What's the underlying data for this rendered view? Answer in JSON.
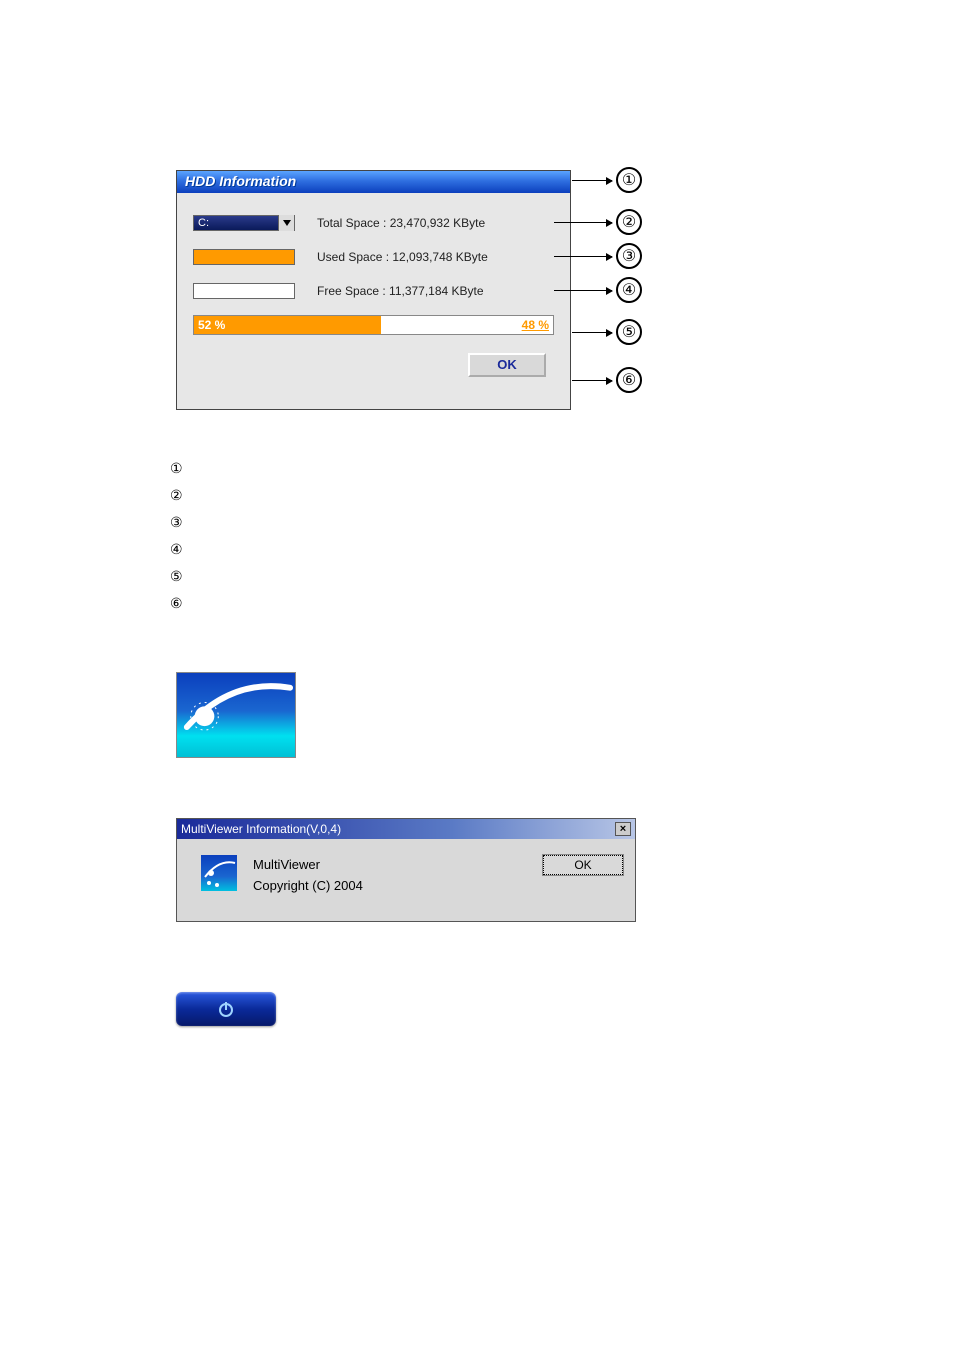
{
  "hdd": {
    "title": "HDD Information",
    "drive_label": "C:",
    "total_label": "Total Space : 23,470,932  KByte",
    "used_label": "Used Space : 12,093,748  KByte",
    "free_label": "Free Space : 11,377,184  KByte",
    "used_pct_label": "52 %",
    "free_pct_label": "48 %",
    "used_pct": 52,
    "ok_label": "OK"
  },
  "callouts": [
    "①",
    "②",
    "③",
    "④",
    "⑤",
    "⑥"
  ],
  "list": [
    "①",
    "②",
    "③",
    "④",
    "⑤",
    "⑥"
  ],
  "mv": {
    "title": "MultiViewer Information(V,0,4)",
    "name": "MultiViewer",
    "copyright": "Copyright (C) 2004",
    "ok": "OK",
    "close": "×"
  }
}
